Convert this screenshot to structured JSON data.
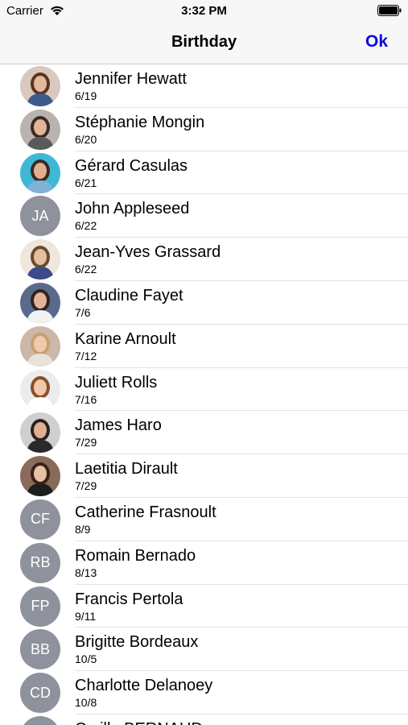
{
  "status": {
    "carrier": "Carrier",
    "time": "3:32 PM"
  },
  "nav": {
    "title": "Birthday",
    "ok_label": "Ok"
  },
  "contacts": [
    {
      "name": "Jennifer Hewatt",
      "date": "6/19",
      "initials": "",
      "photo": {
        "bg": "#d9c8bd",
        "hair": "#5a3522",
        "skin": "#e4b89b",
        "shirt": "#3b5b8c"
      }
    },
    {
      "name": "Stéphanie Mongin",
      "date": "6/20",
      "initials": "",
      "photo": {
        "bg": "#b8b3b0",
        "hair": "#3d2a22",
        "skin": "#e3b49a",
        "shirt": "#5a5a5a"
      }
    },
    {
      "name": "Gérard Casulas",
      "date": "6/21",
      "initials": "",
      "photo": {
        "bg": "#3fb8d6",
        "hair": "#3a2a20",
        "skin": "#e2b090",
        "shirt": "#7fb2d8"
      }
    },
    {
      "name": "John Appleseed",
      "date": "6/22",
      "initials": "JA",
      "photo": null
    },
    {
      "name": "Jean-Yves Grassard",
      "date": "6/22",
      "initials": "",
      "photo": {
        "bg": "#efe6dc",
        "hair": "#6a4a30",
        "skin": "#e5bfa0",
        "shirt": "#3a4a8a"
      }
    },
    {
      "name": "Claudine Fayet",
      "date": "7/6",
      "initials": "",
      "photo": {
        "bg": "#5a6a8a",
        "hair": "#2e2422",
        "skin": "#e3b49a",
        "shirt": "#f2f2f2"
      }
    },
    {
      "name": "Karine Arnoult",
      "date": "7/12",
      "initials": "",
      "photo": {
        "bg": "#cbb8a8",
        "hair": "#c9a071",
        "skin": "#efc9ad",
        "shirt": "#e8e2da"
      }
    },
    {
      "name": "Juliett Rolls",
      "date": "7/16",
      "initials": "",
      "photo": {
        "bg": "#ececec",
        "hair": "#8a4d2a",
        "skin": "#f0c8ac",
        "shirt": "#ffffff"
      }
    },
    {
      "name": "James Haro",
      "date": "7/29",
      "initials": "",
      "photo": {
        "bg": "#cfcfcf",
        "hair": "#2a2220",
        "skin": "#e0b090",
        "shirt": "#2a2a2a"
      }
    },
    {
      "name": "Laetitia Dirault",
      "date": "7/29",
      "initials": "",
      "photo": {
        "bg": "#8a6a5a",
        "hair": "#3a2218",
        "skin": "#e8c0a2",
        "shirt": "#1e1e1e"
      }
    },
    {
      "name": "Catherine Frasnoult",
      "date": "8/9",
      "initials": "CF",
      "photo": null
    },
    {
      "name": "Romain Bernado",
      "date": "8/13",
      "initials": "RB",
      "photo": null
    },
    {
      "name": "Francis Pertola",
      "date": "9/11",
      "initials": "FP",
      "photo": null
    },
    {
      "name": "Brigitte Bordeaux",
      "date": "10/5",
      "initials": "BB",
      "photo": null
    },
    {
      "name": "Charlotte Delanoey",
      "date": "10/8",
      "initials": "CD",
      "photo": null
    },
    {
      "name": "Cyrille BERNAUD",
      "date": "",
      "initials": "",
      "photo": null
    }
  ],
  "colors": {
    "accent": "#0a0ae0",
    "avatar_placeholder": "#8d929c",
    "separator": "#e2e2e2"
  }
}
